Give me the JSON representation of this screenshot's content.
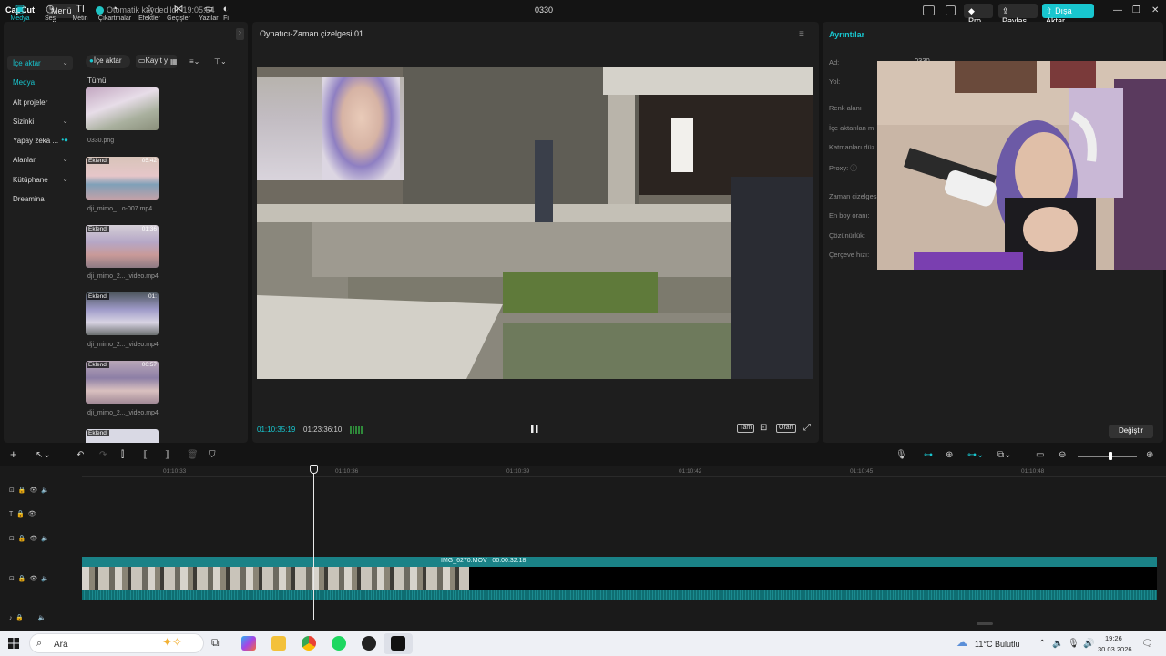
{
  "titlebar": {
    "logo": "CapCut",
    "menu_label": "Menü",
    "save_status": "Otomatik kaydedildi: 19:05:54",
    "project_name": "0330",
    "pro_label": "Pro",
    "share_label": "Paylaş",
    "export_label": "Dışa Aktar"
  },
  "tabs": [
    {
      "label": "Medya",
      "icon": "media-icon"
    },
    {
      "label": "Ses",
      "icon": "audio-icon"
    },
    {
      "label": "Metin",
      "icon": "text-icon"
    },
    {
      "label": "Çıkartmalar",
      "icon": "sticker-icon"
    },
    {
      "label": "Efektler",
      "icon": "effects-icon"
    },
    {
      "label": "Geçişler",
      "icon": "transitions-icon"
    },
    {
      "label": "Yazılar",
      "icon": "captions-icon"
    },
    {
      "label": "Fi",
      "icon": "filter-icon"
    }
  ],
  "sidebar": [
    {
      "label": "İçe aktar",
      "has_chevron": true
    },
    {
      "label": "Medya",
      "has_chevron": false
    },
    {
      "label": "Alt projeler",
      "has_chevron": false
    },
    {
      "label": "Sizinki",
      "has_chevron": true
    },
    {
      "label": "Yapay zeka ...",
      "has_chevron": false
    },
    {
      "label": "Alanlar",
      "has_chevron": true
    },
    {
      "label": "Kütüphane",
      "has_chevron": true
    },
    {
      "label": "Dreamina",
      "has_chevron": false
    }
  ],
  "media_panel": {
    "import_label": "İçe aktar",
    "record_label": "Kayıt y",
    "filter_all": "Tümü",
    "items": [
      {
        "name": "0330.png",
        "badge": "",
        "duration": ""
      },
      {
        "name": "dji_mimo_...o-007.mp4",
        "badge": "Eklendi",
        "duration": "05:42"
      },
      {
        "name": "dji_mimo_2..._video.mp4",
        "badge": "Eklendi",
        "duration": "01:36"
      },
      {
        "name": "dji_mimo_2..._video.mp4",
        "badge": "Eklendi",
        "duration": "01:"
      },
      {
        "name": "dji_mimo_2..._video.mp4",
        "badge": "Eklendi",
        "duration": "00:57"
      },
      {
        "name": "",
        "badge": "Eklendi",
        "duration": ""
      }
    ]
  },
  "player": {
    "title": "Oynatıcı-Zaman çizelgesi 01",
    "current_time": "01:10:35:19",
    "total_time": "01:23:36:10",
    "btn_full": "Tam",
    "btn_ratio": "Oran"
  },
  "details": {
    "title": "Ayrıntılar",
    "labels": [
      "Ad:",
      "Yol:",
      "Renk alanı",
      "İçe aktarılan m",
      "Katmanları düz",
      "Proxy: ⓘ",
      "Zaman çizelges",
      "En boy oranı:",
      "Çözünürlük:",
      "Çerçeve hızı:"
    ],
    "name_value": "0330",
    "change_label": "Değiştir"
  },
  "timeline": {
    "ticks": [
      "01:10:33",
      "01:10:36",
      "01:10:39",
      "01:10:42",
      "01:10:45",
      "01:10:48"
    ],
    "clip_name": "IMG_6270.MOV",
    "clip_duration": "00:00:32:18"
  },
  "taskbar": {
    "search_placeholder": "Ara",
    "temperature": "11°C",
    "weather": "Bulutlu",
    "time": "19:26",
    "date": "30.03.2026"
  },
  "colors": {
    "accent": "#18c6cf",
    "panel": "#1e1e1e",
    "clip": "#1a8287"
  }
}
